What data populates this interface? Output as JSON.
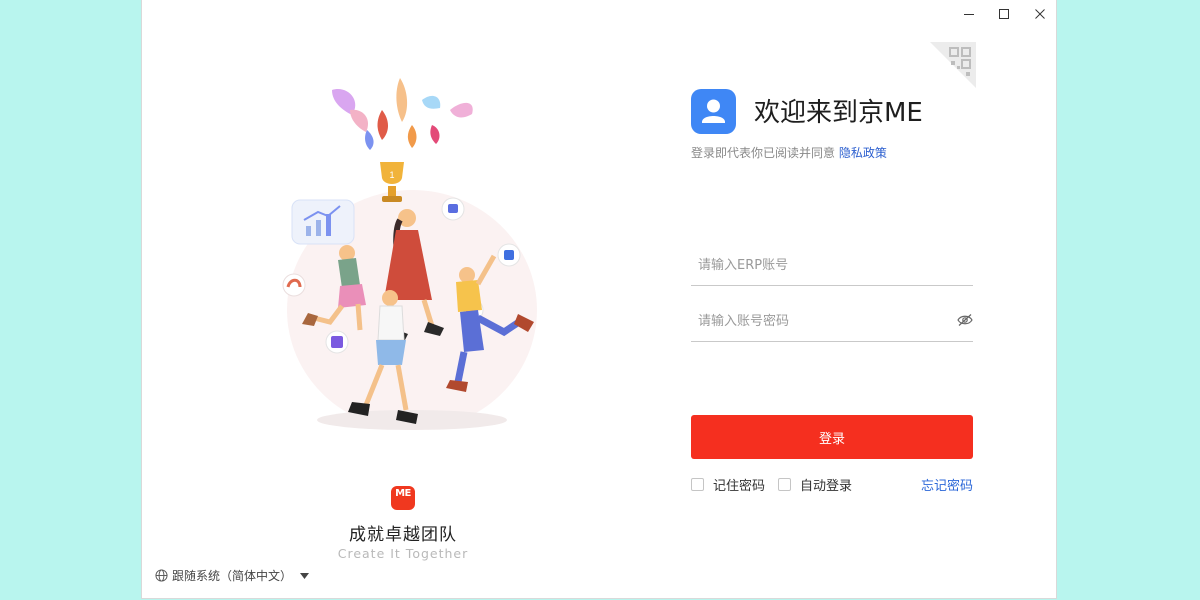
{
  "window": {
    "controls": {
      "minimize_icon": "minimize-icon",
      "maximize_icon": "maximize-icon",
      "close_icon": "close-icon"
    }
  },
  "left": {
    "brand_logo_text": "ME",
    "slogan_cn": "成就卓越团队",
    "slogan_en": "Create  It Together",
    "language_selector": "跟随系统（简体中文）"
  },
  "right": {
    "welcome_title": "欢迎来到京ME",
    "agreement_prefix": "登录即代表你已阅读并同意",
    "privacy_link": "隐私政策",
    "erp_placeholder": "请输入ERP账号",
    "password_placeholder": "请输入账号密码",
    "login_label": "登录",
    "remember_password": "记住密码",
    "auto_login": "自动登录",
    "forgot_password": "忘记密码"
  },
  "colors": {
    "background": "#b8f5ee",
    "primary_button": "#f52f1f",
    "avatar": "#3f87f5",
    "link": "#2b67d8",
    "brand": "#f0381f"
  }
}
